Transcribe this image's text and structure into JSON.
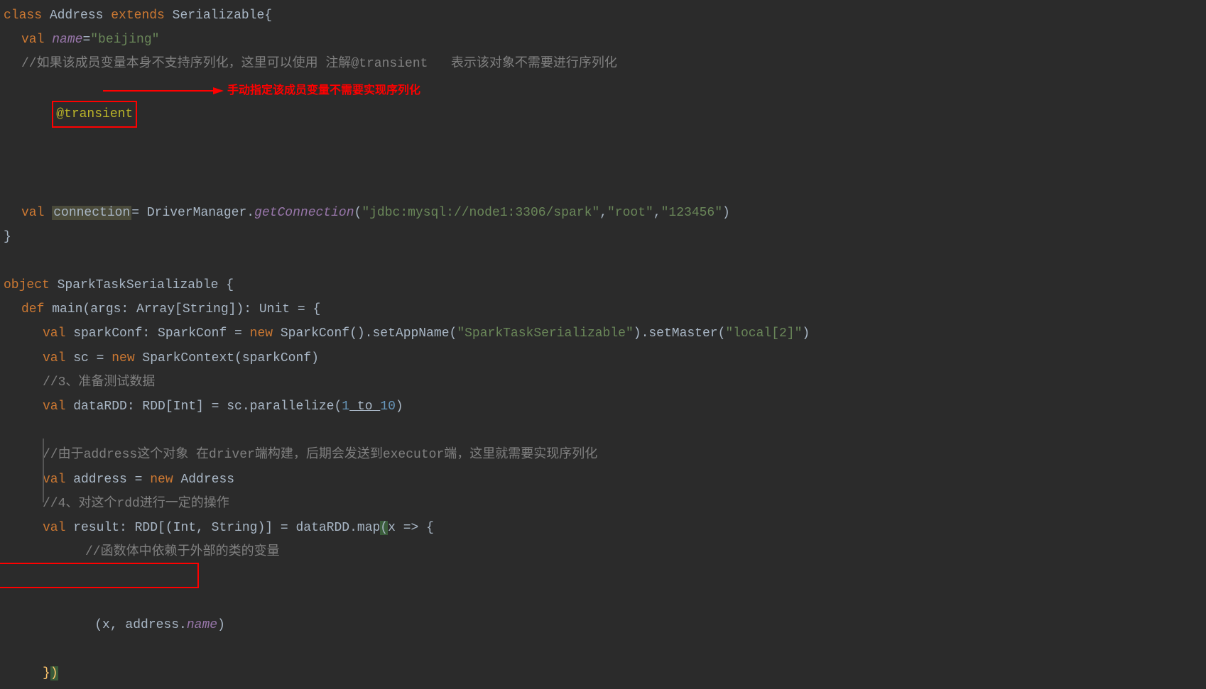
{
  "code": {
    "line1": {
      "keyword_class": "class",
      "class_name": " Address ",
      "keyword_extends": "extends",
      "parent": " Serializable{"
    },
    "line2": {
      "keyword_val": "val",
      "space1": " ",
      "field": "name",
      "equals": "=",
      "string": "\"beijing\""
    },
    "line3": {
      "comment": "//如果该成员变量本身不支持序列化，这里可以使用 注解@transient   表示该对象不需要进行序列化"
    },
    "line4": {
      "annotation": "@transient",
      "red_text": "手动指定该成员变量不需要实现序列化"
    },
    "line5": {
      "keyword_val": "val",
      "space1": " ",
      "var": "connection",
      "equals": "= DriverManager.",
      "method": "getConnection",
      "paren_open": "(",
      "str1": "\"jdbc:mysql://node1:3306/spark\"",
      "comma1": ",",
      "str2": "\"root\"",
      "comma2": ",",
      "str3": "\"123456\"",
      "paren_close": ")"
    },
    "line6": {
      "brace": "}"
    },
    "line8": {
      "keyword_object": "object",
      "name": " SparkTaskSerializable {"
    },
    "line9": {
      "keyword_def": "def",
      "method_name": " main(args: Array[",
      "type": "String",
      "rest": "]): Unit = {"
    },
    "line10": {
      "keyword_val": "val",
      "text1": " sparkConf: SparkConf = ",
      "keyword_new": "new",
      "text2": " SparkConf().setAppName(",
      "str1": "\"SparkTaskSerializable\"",
      "text3": ").setMaster(",
      "str2": "\"local[2]\"",
      "text4": ")"
    },
    "line11": {
      "keyword_val": "val",
      "text1": " sc = ",
      "keyword_new": "new",
      "text2": " SparkContext(sparkConf)"
    },
    "line12": {
      "comment": "//3、准备测试数据"
    },
    "line13": {
      "keyword_val": "val",
      "text1": " dataRDD: RDD[",
      "type": "Int",
      "text2": "] = sc.parallelize(",
      "num1": "1",
      "to": " to ",
      "num2": "10",
      "text3": ")"
    },
    "line15": {
      "comment": "//由于address这个对象 在driver端构建，后期会发送到executor端，这里就需要实现序列化"
    },
    "line16": {
      "keyword_val": "val",
      "text1": " address = ",
      "keyword_new": "new",
      "text2": " Address"
    },
    "line17": {
      "comment": "//4、对这个rdd进行一定的操作"
    },
    "line18": {
      "keyword_val": "val",
      "text1": " result: RDD[(",
      "type1": "Int",
      "comma": ", ",
      "type2": "String",
      "text2": ")] = dataRDD.map",
      "paren_open": "(",
      "text3": "x => {"
    },
    "line19": {
      "comment": "//函数体中依赖于外部的类的变量"
    },
    "line20": {
      "text1": "(x, address.",
      "field": "name",
      "text2": ")"
    },
    "line21": {
      "brace_close": "}",
      "paren_close": ")"
    }
  }
}
